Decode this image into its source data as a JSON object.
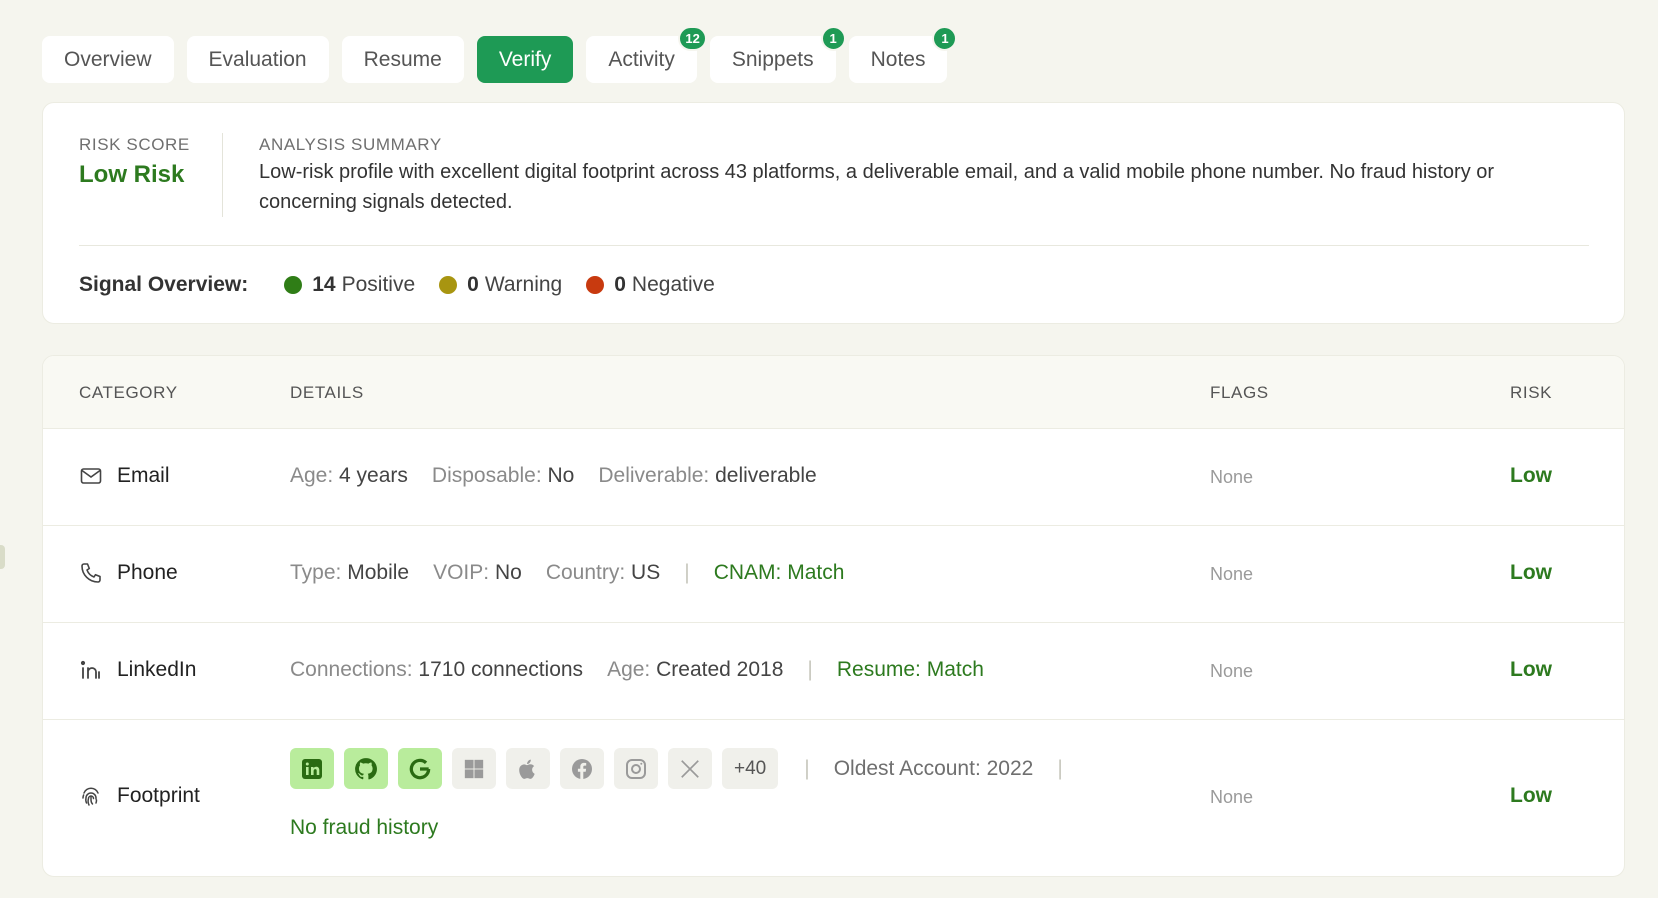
{
  "tabs": [
    {
      "label": "Overview",
      "badge": null,
      "active": false
    },
    {
      "label": "Evaluation",
      "badge": null,
      "active": false
    },
    {
      "label": "Resume",
      "badge": null,
      "active": false
    },
    {
      "label": "Verify",
      "badge": null,
      "active": true
    },
    {
      "label": "Activity",
      "badge": "12",
      "active": false
    },
    {
      "label": "Snippets",
      "badge": "1",
      "active": false
    },
    {
      "label": "Notes",
      "badge": "1",
      "active": false
    }
  ],
  "summary": {
    "risk_label": "RISK SCORE",
    "risk_value": "Low Risk",
    "analysis_label": "ANALYSIS SUMMARY",
    "analysis_text": "Low-risk profile with excellent digital footprint across 43 platforms, a deliverable email, and a valid mobile phone number. No fraud history or concerning signals detected."
  },
  "signals": {
    "label": "Signal Overview:",
    "positive_count": "14",
    "positive_label": "Positive",
    "positive_color": "#2f7d16",
    "warning_count": "0",
    "warning_label": "Warning",
    "warning_color": "#a89510",
    "negative_count": "0",
    "negative_label": "Negative",
    "negative_color": "#c83a0f"
  },
  "table": {
    "headers": {
      "category": "CATEGORY",
      "details": "DETAILS",
      "flags": "FLAGS",
      "risk": "RISK"
    },
    "email": {
      "category": "Email",
      "icon": "mail-icon",
      "age_k": "Age:",
      "age_v": "4 years",
      "disp_k": "Disposable:",
      "disp_v": "No",
      "deliv_k": "Deliverable:",
      "deliv_v": "deliverable",
      "flags": "None",
      "risk": "Low"
    },
    "phone": {
      "category": "Phone",
      "icon": "phone-icon",
      "type_k": "Type:",
      "type_v": "Mobile",
      "voip_k": "VOIP:",
      "voip_v": "No",
      "country_k": "Country:",
      "country_v": "US",
      "sep": "|",
      "cnam": "CNAM: Match",
      "flags": "None",
      "risk": "Low"
    },
    "linkedin": {
      "category": "LinkedIn",
      "icon": "linkedin-icon",
      "conn_k": "Connections:",
      "conn_v": "1710 connections",
      "age_k": "Age:",
      "age_v": "Created 2018",
      "sep": "|",
      "resume": "Resume: Match",
      "flags": "None",
      "risk": "Low"
    },
    "footprint": {
      "category": "Footprint",
      "icon": "fingerprint-icon",
      "platforms": [
        "linkedin",
        "github",
        "google",
        "microsoft",
        "apple",
        "facebook",
        "instagram",
        "x"
      ],
      "more": "+40",
      "sep": "|",
      "oldest": "Oldest Account: 2022",
      "fraud": "No fraud history",
      "flags": "None",
      "risk": "Low"
    }
  }
}
